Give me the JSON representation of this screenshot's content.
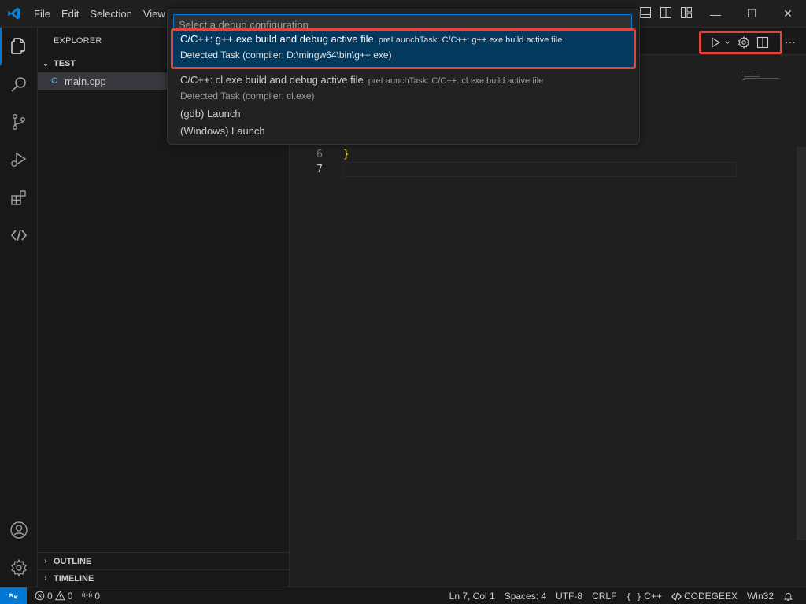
{
  "menu": [
    "File",
    "Edit",
    "Selection",
    "View"
  ],
  "window_controls": {
    "minimize": "—",
    "maximize": "☐",
    "close": "✕"
  },
  "sidebar": {
    "title": "EXPLORER",
    "folder": "TEST",
    "file": "main.cpp",
    "file_icon": "C",
    "outline": "OUTLINE",
    "timeline": "TIMELINE"
  },
  "editor": {
    "lines": [
      {
        "no": "6",
        "text": "}"
      },
      {
        "no": "7",
        "text": ""
      }
    ],
    "more": "···"
  },
  "quickpick": {
    "placeholder": "Select a debug configuration",
    "items": [
      {
        "label": "C/C++: g++.exe build and debug active file",
        "description": "preLaunchTask: C/C++: g++.exe build active file",
        "detail": "Detected Task (compiler: D:\\mingw64\\bin\\g++.exe)"
      },
      {
        "label": "C/C++: cl.exe build and debug active file",
        "description": "preLaunchTask: C/C++: cl.exe build active file",
        "detail": "Detected Task (compiler: cl.exe)"
      },
      {
        "label": "(gdb) Launch"
      },
      {
        "label": "(Windows) Launch"
      }
    ]
  },
  "statusbar": {
    "errors": "0",
    "warnings": "0",
    "ports": "0",
    "position": "Ln 7, Col 1",
    "spaces": "Spaces: 4",
    "encoding": "UTF-8",
    "eol": "CRLF",
    "language_braces": "{ }",
    "language": "C++",
    "codegeex": "CODEGEEX",
    "platform": "Win32"
  },
  "colors": {
    "accent": "#0078d4",
    "highlight_border": "#e0443c",
    "selection": "#04395e"
  }
}
